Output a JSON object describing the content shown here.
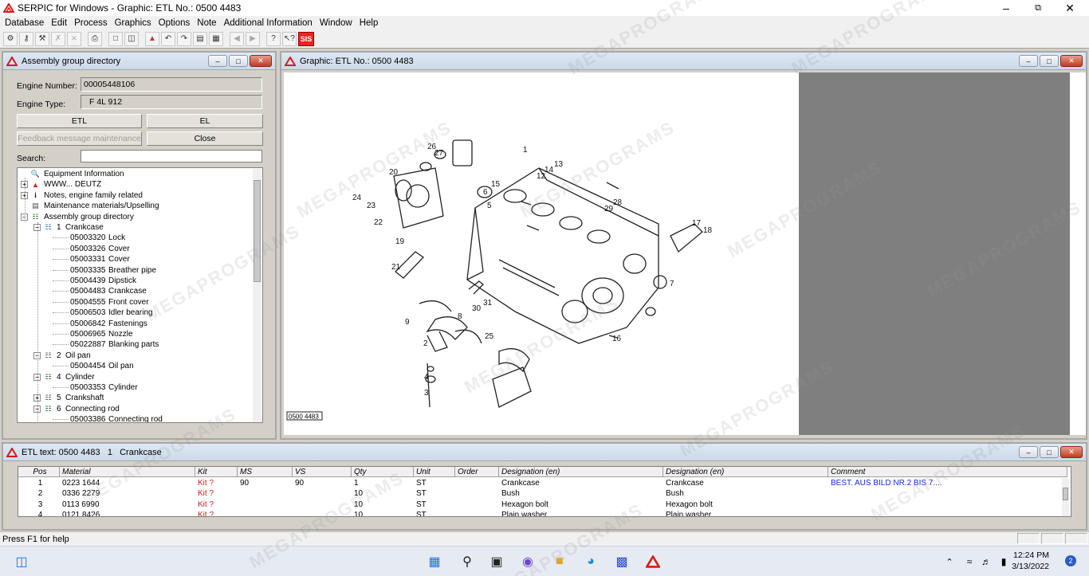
{
  "window": {
    "title": "SERPIC for Windows - Graphic: ETL No.: 0500 4483"
  },
  "menu": [
    "Database",
    "Edit",
    "Process",
    "Graphics",
    "Options",
    "Note",
    "Additional Information",
    "Window",
    "Help"
  ],
  "toolbar": {
    "sis_label": "SIS"
  },
  "assembly_pane": {
    "title": "Assembly group directory",
    "engine_number_label": "Engine Number:",
    "engine_number": "00005448106",
    "engine_type_label": "Engine Type:",
    "engine_type": "F 4L 912",
    "btn_etl": "ETL",
    "btn_el": "EL",
    "btn_feedback": "Feedback message maintenance",
    "btn_close": "Close",
    "search_label": "Search:",
    "search_value": "",
    "tree": [
      {
        "num": "",
        "label": "Equipment Information",
        "level": 0,
        "exp": "",
        "icon": "search-doc-icon"
      },
      {
        "num": "",
        "label": "WWW... DEUTZ",
        "level": 0,
        "exp": "+",
        "icon": "deutz-logo-icon"
      },
      {
        "num": "",
        "label": "Notes, engine family related",
        "level": 0,
        "exp": "+",
        "icon": "info-icon"
      },
      {
        "num": "",
        "label": "Maintenance materials/Upselling",
        "level": 0,
        "exp": "",
        "icon": "catalog-icon"
      },
      {
        "num": "",
        "label": "Assembly group directory",
        "level": 0,
        "exp": "-",
        "icon": "group-tree-icon"
      },
      {
        "num": "1",
        "label": "Crankcase",
        "level": 1,
        "exp": "-",
        "icon": "group-selected-icon"
      },
      {
        "num": "05003320",
        "label": "Lock",
        "level": 2,
        "exp": "",
        "icon": ""
      },
      {
        "num": "05003326",
        "label": "Cover",
        "level": 2,
        "exp": "",
        "icon": ""
      },
      {
        "num": "05003331",
        "label": "Cover",
        "level": 2,
        "exp": "",
        "icon": ""
      },
      {
        "num": "05003335",
        "label": "Breather pipe",
        "level": 2,
        "exp": "",
        "icon": ""
      },
      {
        "num": "05004439",
        "label": "Dipstick",
        "level": 2,
        "exp": "",
        "icon": ""
      },
      {
        "num": "05004483",
        "label": "Crankcase",
        "level": 2,
        "exp": "",
        "icon": ""
      },
      {
        "num": "05004555",
        "label": "Front cover",
        "level": 2,
        "exp": "",
        "icon": ""
      },
      {
        "num": "05006503",
        "label": "Idler bearing",
        "level": 2,
        "exp": "",
        "icon": ""
      },
      {
        "num": "05006842",
        "label": "Fastenings",
        "level": 2,
        "exp": "",
        "icon": ""
      },
      {
        "num": "05006965",
        "label": "Nozzle",
        "level": 2,
        "exp": "",
        "icon": ""
      },
      {
        "num": "05022887",
        "label": "Blanking parts",
        "level": 2,
        "exp": "",
        "icon": ""
      },
      {
        "num": "2",
        "label": "Oil pan",
        "level": 1,
        "exp": "-",
        "icon": "group-icon"
      },
      {
        "num": "05004454",
        "label": "Oil pan",
        "level": 2,
        "exp": "",
        "icon": ""
      },
      {
        "num": "4",
        "label": "Cylinder",
        "level": 1,
        "exp": "-",
        "icon": "group-icon"
      },
      {
        "num": "05003353",
        "label": "Cylinder",
        "level": 2,
        "exp": "",
        "icon": ""
      },
      {
        "num": "5",
        "label": "Crankshaft",
        "level": 1,
        "exp": "+",
        "icon": "group-icon"
      },
      {
        "num": "6",
        "label": "Connecting rod",
        "level": 1,
        "exp": "-",
        "icon": "group-icon"
      },
      {
        "num": "05003386",
        "label": "Connecting rod",
        "level": 2,
        "exp": "",
        "icon": ""
      }
    ]
  },
  "graphic_pane": {
    "title": "Graphic: ETL No.: 0500 4483",
    "drawing_tag": "0500 4483",
    "callouts": [
      "1",
      "2",
      "3",
      "4",
      "5",
      "6",
      "7",
      "8",
      "9",
      "12",
      "13",
      "14",
      "15",
      "16",
      "17",
      "18",
      "19",
      "20",
      "21",
      "22",
      "23",
      "24",
      "25",
      "26",
      "27",
      "28",
      "29",
      "30",
      "31"
    ]
  },
  "etl_pane": {
    "title": "ETL text: 0500 4483   1   Crankcase",
    "columns": [
      "Pos",
      "Material",
      "Kit",
      "MS",
      "VS",
      "Qty",
      "Unit",
      "Order",
      "Designation (en)",
      "Designation (en)",
      "Comment"
    ],
    "rows": [
      {
        "pos": "1",
        "material": "0223 1644",
        "kit": "Kit ?",
        "ms": "90",
        "vs": "90",
        "qty": "1",
        "unit": "ST",
        "order": "",
        "des1": "Crankcase",
        "des2": "Crankcase",
        "comment": "BEST. AUS BILD NR.2 BIS 7...."
      },
      {
        "pos": "2",
        "material": "0336 2279",
        "kit": "Kit ?",
        "ms": "",
        "vs": "",
        "qty": "10",
        "unit": "ST",
        "order": "",
        "des1": "Bush",
        "des2": "Bush",
        "comment": ""
      },
      {
        "pos": "3",
        "material": "0113 6990",
        "kit": "Kit ?",
        "ms": "",
        "vs": "",
        "qty": "10",
        "unit": "ST",
        "order": "",
        "des1": "Hexagon bolt",
        "des2": "Hexagon bolt",
        "comment": ""
      },
      {
        "pos": "4",
        "material": "0121 8426",
        "kit": "Kit ?",
        "ms": "",
        "vs": "",
        "qty": "10",
        "unit": "ST",
        "order": "",
        "des1": "Plain washer",
        "des2": "Plain washer",
        "comment": ""
      }
    ]
  },
  "status": {
    "text": "Press F1 for help"
  },
  "taskbar": {
    "time": "12:24 PM",
    "date": "3/13/2022",
    "notifications": "2"
  },
  "watermark": "MEGAPROGRAMS",
  "colors": {
    "deutz_red": "#d41c1c",
    "kit_red": "#d02020",
    "comment_blue": "#1a28d0",
    "grey_area": "#7f7f7f"
  }
}
